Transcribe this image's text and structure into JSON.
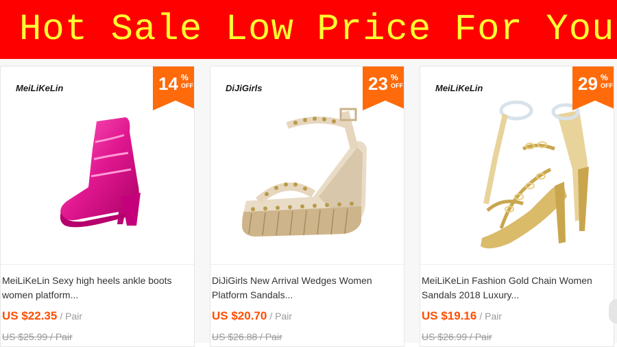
{
  "banner": {
    "title": "Hot Sale Low Price For You"
  },
  "colors": {
    "banner_bg": "#ff0000",
    "banner_text": "#ffff33",
    "badge": "#ff6a0a",
    "price": "#ff4e00"
  },
  "products": [
    {
      "brand_logo": "MeiLiKeLin",
      "discount": {
        "number": "14",
        "percent": "%",
        "off": "OFF"
      },
      "image_icon": "pink-ankle-boot-icon",
      "title": "MeiLiKeLin Sexy high heels ankle boots women platform...",
      "price": "US $22.35",
      "unit": "/ Pair",
      "old_price": "US $25.99 / Pair"
    },
    {
      "brand_logo": "DiJiGirls",
      "discount": {
        "number": "23",
        "percent": "%",
        "off": "OFF"
      },
      "image_icon": "wedge-sandal-icon",
      "title": "DiJiGirls New Arrival Wedges Women Platform Sandals...",
      "price": "US $20.70",
      "unit": "/ Pair",
      "old_price": "US $26.88 / Pair"
    },
    {
      "brand_logo": "MeiLiKeLin",
      "discount": {
        "number": "29",
        "percent": "%",
        "off": "OFF"
      },
      "image_icon": "gold-chain-sandal-icon",
      "title": "MeiLiKeLin Fashion Gold Chain Women Sandals 2018 Luxury...",
      "price": "US $19.16",
      "unit": "/ Pair",
      "old_price": "US $26.99 / Pair"
    }
  ]
}
